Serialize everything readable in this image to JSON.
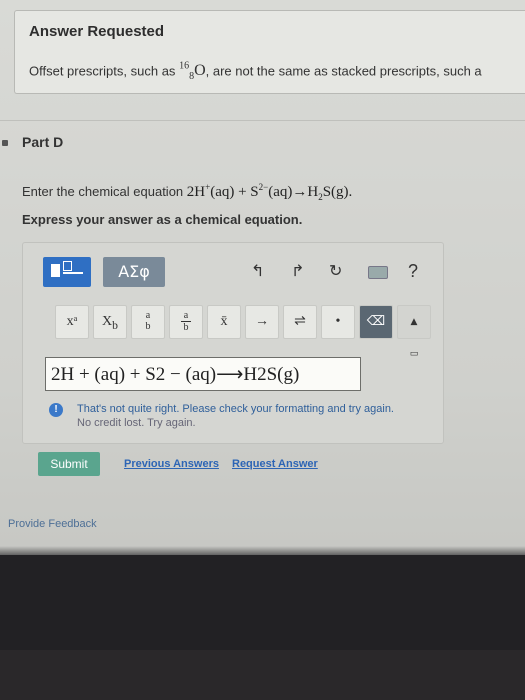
{
  "answer_requested": {
    "title": "Answer Requested",
    "text_before": "Offset prescripts, such as",
    "nuclide_mass": "16",
    "nuclide_atomic": "8",
    "nuclide_symbol": "O",
    "text_after": ", are not the same as stacked prescripts, such a"
  },
  "part": {
    "label": "Part D"
  },
  "prompt": {
    "intro": "Enter the chemical equation",
    "eq_h": "2H",
    "eq_h_charge": "+",
    "eq_aq1": "(aq) + S",
    "eq_s_charge": "2−",
    "eq_aq2": "(aq)→H",
    "eq_sub2": "2",
    "eq_end": "S(g).",
    "instruction": "Express your answer as a chemical equation."
  },
  "toolbar": {
    "greek_label": "ΑΣφ",
    "undo": "↰",
    "redo": "↱",
    "reset": "↻",
    "help": "?"
  },
  "symbols": {
    "superscript": "xᵃ",
    "subscript": "X",
    "subscript_sub": "b",
    "stack_top": "a",
    "stack_bottom": "b",
    "frac_top": "a",
    "frac_bottom": "b",
    "overline": "x̄",
    "arrow": "→",
    "equilibrium": "⇌",
    "dot": "•"
  },
  "answer": {
    "value": "2H + (aq) + S2 − (aq)⟶H2S(g)"
  },
  "feedback": {
    "icon": "!",
    "line1": "That's not quite right. Please check your formatting and try again.",
    "line2": "No credit lost. Try again."
  },
  "actions": {
    "submit": "Submit",
    "previous": "Previous Answers",
    "request": "Request Answer"
  },
  "provide_feedback": "Provide Feedback",
  "colors": {
    "accent_blue": "#2f6fc3",
    "submit_green": "#5aa58e",
    "link_blue": "#2d65b5"
  }
}
